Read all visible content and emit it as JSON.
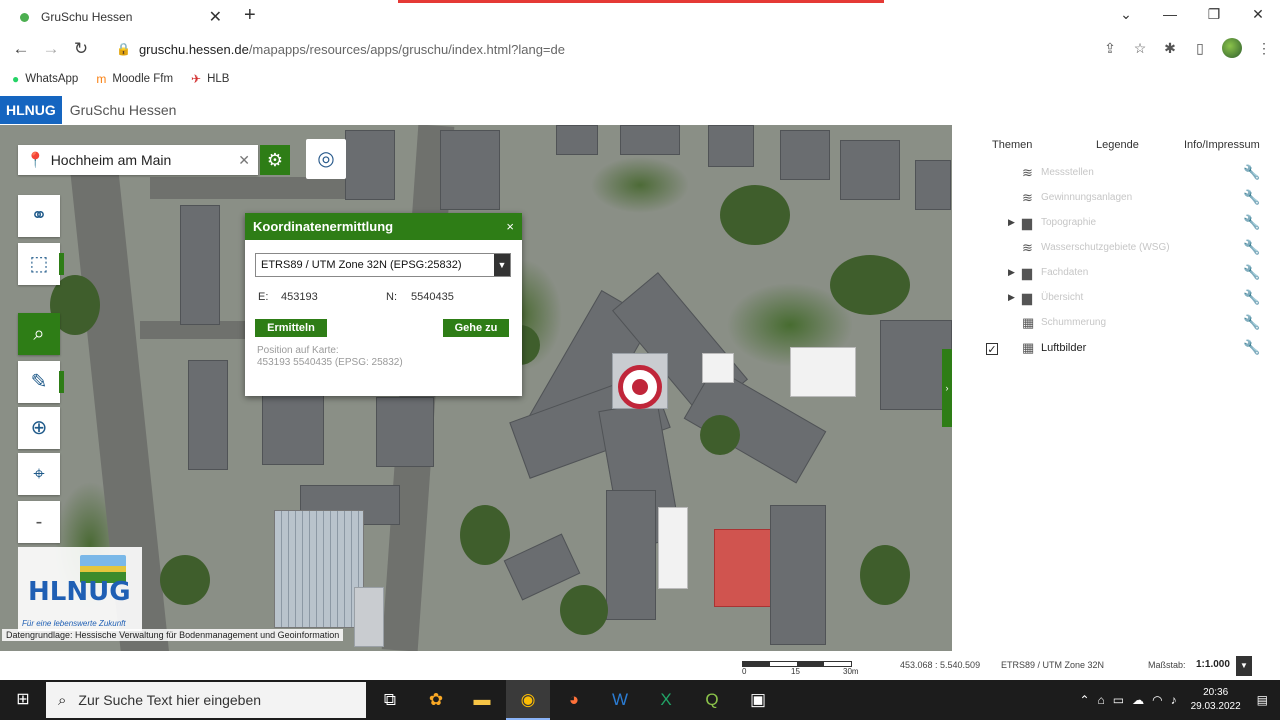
{
  "browser": {
    "tab_title": "GruSchu Hessen",
    "tab_close": "✕",
    "new_tab": "+",
    "window_controls": [
      "⌄",
      "—",
      "❐",
      "✕"
    ],
    "url_host": "gruschu.hessen.de",
    "url_path": "/mapapps/resources/apps/gruschu/index.html?lang=de",
    "bookmarks": [
      {
        "label": "WhatsApp",
        "icon": "whatsapp-icon"
      },
      {
        "label": "Moodle Ffm",
        "icon": "moodle-icon"
      },
      {
        "label": "HLB",
        "icon": "hlb-icon"
      }
    ]
  },
  "app": {
    "badge": "HLNUG",
    "title": "GruSchu Hessen"
  },
  "map": {
    "search_value": "Hochheim am Main",
    "tool_minus": "-",
    "logo_text": "HLNUG",
    "logo_tagline": "Für eine lebenswerte Zukunft",
    "attribution": "Datengrundlage: Hessische Verwaltung für Bodenmanagement und Geoinformation"
  },
  "popup": {
    "title": "Koordinatenermittlung",
    "close": "×",
    "crs_selected": "ETRS89 / UTM Zone 32N (EPSG:25832)",
    "e_label": "E:",
    "e_value": "453193",
    "n_label": "N:",
    "n_value": "5540435",
    "btn_ermitteln": "Ermitteln",
    "btn_gehe_zu": "Gehe zu",
    "position_label": "Position auf Karte:",
    "position_value": "453193 5540435 (EPSG: 25832)"
  },
  "panel": {
    "tabs": [
      "Themen",
      "Legende",
      "Info/Impressum"
    ],
    "layers": [
      {
        "label": "Messstellen",
        "icon": "layers-icon",
        "expand": false,
        "checked": false
      },
      {
        "label": "Gewinnungsanlagen",
        "icon": "layers-icon",
        "expand": false,
        "checked": false
      },
      {
        "label": "Topographie",
        "icon": "folder-icon",
        "expand": true,
        "checked": false
      },
      {
        "label": "Wasserschutzgebiete (WSG)",
        "icon": "layers-icon",
        "expand": false,
        "checked": false
      },
      {
        "label": "Fachdaten",
        "icon": "folder-icon",
        "expand": true,
        "checked": false
      },
      {
        "label": "Übersicht",
        "icon": "folder-icon",
        "expand": true,
        "checked": false
      },
      {
        "label": "Schummerung",
        "icon": "grid-icon",
        "expand": false,
        "checked": false
      },
      {
        "label": "Luftbilder",
        "icon": "grid-icon",
        "expand": false,
        "checked": true
      }
    ]
  },
  "status": {
    "scale_labels": [
      "0",
      "15",
      "30m"
    ],
    "cursor_coords": "453.068 : 5.540.509",
    "crs": "ETRS89 / UTM Zone 32N",
    "scale_label": "Maßstab:",
    "scale_value": "1:1.000"
  },
  "taskbar": {
    "search_placeholder": "Zur Suche Text hier eingeben",
    "time": "20:36",
    "date": "29.03.2022"
  },
  "colors": {
    "accent_green": "#2e7d16",
    "brand_blue": "#1565c0"
  }
}
